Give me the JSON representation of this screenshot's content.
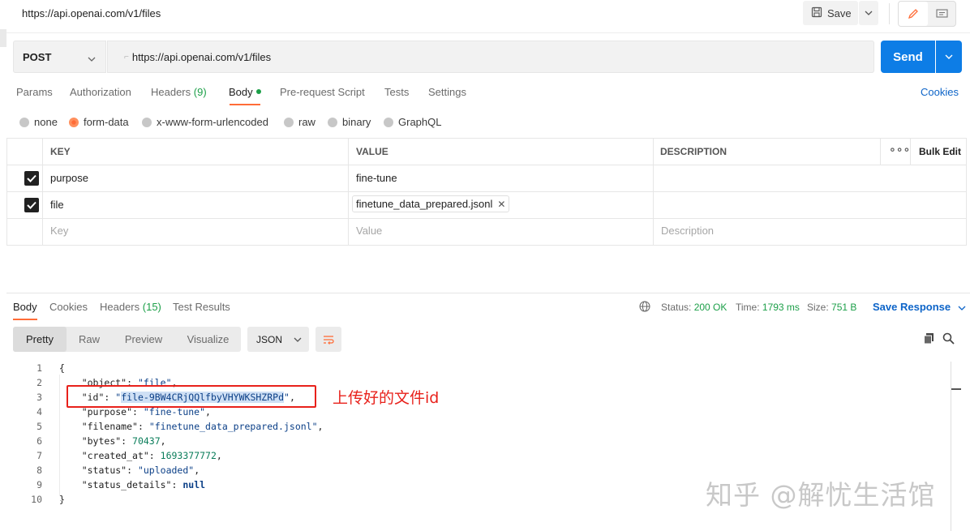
{
  "window": {
    "title": "https://api.openai.com/v1/files"
  },
  "topbar": {
    "save_label": "Save"
  },
  "request": {
    "method": "POST",
    "url": "https://api.openai.com/v1/files",
    "send_label": "Send"
  },
  "request_tabs": [
    {
      "label": "Params"
    },
    {
      "label": "Authorization"
    },
    {
      "label": "Headers",
      "count": "(9)"
    },
    {
      "label": "Body"
    },
    {
      "label": "Pre-request Script"
    },
    {
      "label": "Tests"
    },
    {
      "label": "Settings"
    }
  ],
  "cookies_link": "Cookies",
  "body_types": [
    {
      "label": "none",
      "selected": false
    },
    {
      "label": "form-data",
      "selected": true
    },
    {
      "label": "x-www-form-urlencoded",
      "selected": false
    },
    {
      "label": "raw",
      "selected": false
    },
    {
      "label": "binary",
      "selected": false
    },
    {
      "label": "GraphQL",
      "selected": false
    }
  ],
  "params_table": {
    "headers": {
      "key": "KEY",
      "value": "VALUE",
      "description": "DESCRIPTION",
      "bulk_edit": "Bulk Edit"
    },
    "rows": [
      {
        "checked": true,
        "key": "purpose",
        "value": "fine-tune"
      },
      {
        "checked": true,
        "key": "file",
        "value": "finetune_data_prepared.jsonl"
      }
    ],
    "placeholders": {
      "key": "Key",
      "value": "Value",
      "description": "Description"
    }
  },
  "response": {
    "tabs": [
      {
        "label": "Body"
      },
      {
        "label": "Cookies"
      },
      {
        "label": "Headers",
        "count": "(15)"
      },
      {
        "label": "Test Results"
      }
    ],
    "status_label": "Status:",
    "status_value": "200 OK",
    "time_label": "Time:",
    "time_value": "1793 ms",
    "size_label": "Size:",
    "size_value": "751 B",
    "save_response": "Save Response",
    "views": [
      "Pretty",
      "Raw",
      "Preview",
      "Visualize"
    ],
    "format": "JSON"
  },
  "code_lines": [
    "{",
    "    \"object\": \"file\",",
    "    \"id\": \"file-9BW4CRjQQlfbyVHYWKSHZRPd\",",
    "    \"purpose\": \"fine-tune\",",
    "    \"filename\": \"finetune_data_prepared.jsonl\",",
    "    \"bytes\": 70437,",
    "    \"created_at\": 1693377772,",
    "    \"status\": \"uploaded\",",
    "    \"status_details\": null",
    "}"
  ],
  "code_tokens": {
    "object_key": "\"object\"",
    "object_val": "\"file\"",
    "id_key": "\"id\"",
    "id_val": "file-9BW4CRjQQlfbyVHYWKSHZRPd",
    "purpose_key": "\"purpose\"",
    "purpose_val": "\"fine-tune\"",
    "filename_key": "\"filename\"",
    "filename_val": "\"finetune_data_prepared.jsonl\"",
    "bytes_key": "\"bytes\"",
    "bytes_val": "70437",
    "created_key": "\"created_at\"",
    "created_val": "1693377772",
    "status_key": "\"status\"",
    "status_val": "\"uploaded\"",
    "details_key": "\"status_details\"",
    "details_val": "null"
  },
  "line_numbers": [
    "1",
    "2",
    "3",
    "4",
    "5",
    "6",
    "7",
    "8",
    "9",
    "10"
  ],
  "annotation": "上传好的文件id",
  "watermark": "知乎 @解忧生活馆",
  "colors": {
    "accent": "#ff6c37",
    "send": "#0d7de6",
    "link": "#0d64c8",
    "success": "#1c9f48",
    "annotation": "#e8211b"
  }
}
